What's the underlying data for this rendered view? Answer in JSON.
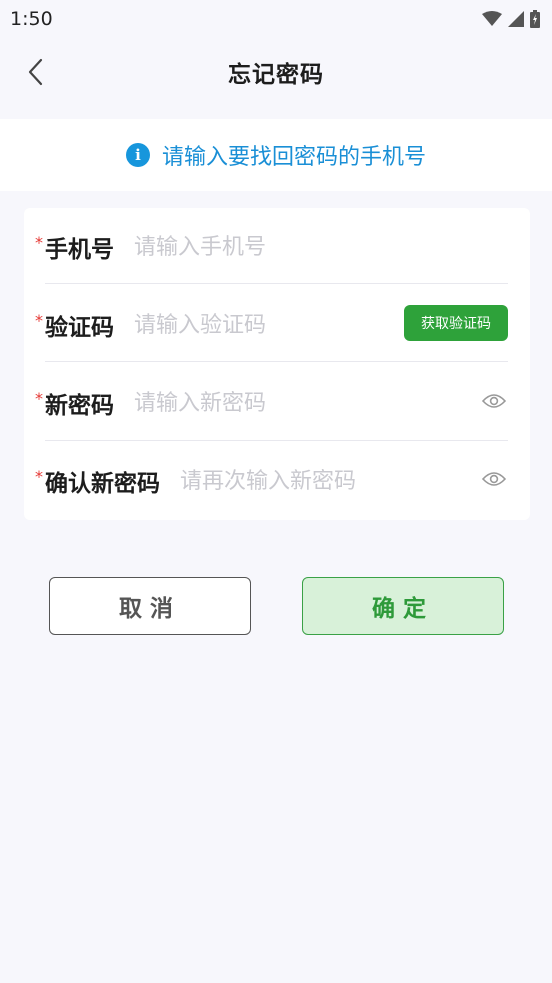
{
  "status_bar": {
    "time": "1:50"
  },
  "nav": {
    "title": "忘记密码"
  },
  "notice": {
    "text": "请输入要找回密码的手机号"
  },
  "form": {
    "phone": {
      "label": "手机号",
      "placeholder": "请输入手机号",
      "value": ""
    },
    "code": {
      "label": "验证码",
      "placeholder": "请输入验证码",
      "value": "",
      "button": "获取验证码"
    },
    "new_password": {
      "label": "新密码",
      "placeholder": "请输入新密码",
      "value": ""
    },
    "confirm_password": {
      "label": "确认新密码",
      "placeholder": "请再次输入新密码",
      "value": ""
    },
    "required_mark": "*"
  },
  "actions": {
    "cancel": "取消",
    "confirm": "确定"
  },
  "colors": {
    "accent_green": "#2ea23a",
    "info_blue": "#1a8fd6",
    "required_red": "#e53935"
  }
}
